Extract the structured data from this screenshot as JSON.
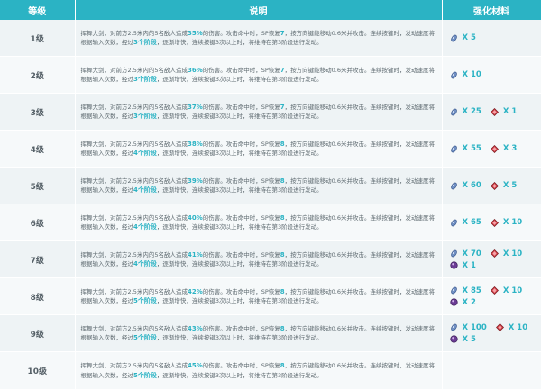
{
  "header": {
    "level": "等级",
    "description": "说明",
    "materials": "强化材料"
  },
  "colors": {
    "header_bg": "#2bb3c4",
    "highlight": "#2bb3c4",
    "row_bg_a": "#eef3f5",
    "row_bg_b": "#f6f9fa"
  },
  "icons": {
    "a": "blue-crystal-icon",
    "b": "red-crystal-icon",
    "c": "purple-orb-icon"
  },
  "rows": [
    {
      "level": "1级",
      "d": [
        "挥舞大剑，对前方2.5米内的5名敌人造成",
        "35%",
        "的伤害。攻击命中时，SP恢复",
        "7",
        "，按方向键能移动0.6米并攻击。连续按键时，发动速度将根据输入次数，经过",
        "3个阶段",
        "，逐渐增快，连续按键3次以上时，将维持在第3阶段进行发动。"
      ],
      "mats": [
        [
          {
            "icon": "blue-crystal-icon",
            "qty": "X 5"
          }
        ]
      ]
    },
    {
      "level": "2级",
      "d": [
        "挥舞大剑，对前方2.5米内的5名敌人造成",
        "36%",
        "的伤害。攻击命中时，SP恢复",
        "7",
        "，按方向键能移动0.6米并攻击。连续按键时，发动速度将根据输入次数，经过",
        "3个阶段",
        "，逐渐增快，连续按键3次以上时，将维持在第3阶段进行发动。"
      ],
      "mats": [
        [
          {
            "icon": "blue-crystal-icon",
            "qty": "X 10"
          }
        ]
      ]
    },
    {
      "level": "3级",
      "d": [
        "挥舞大剑，对前方2.5米内的5名敌人造成",
        "37%",
        "的伤害。攻击命中时，SP恢复",
        "7",
        "，按方向键能移动0.6米并攻击。连续按键时，发动速度将根据输入次数，经过",
        "3个阶段",
        "，逐渐增快，连续按键3次以上时，将维持在第3阶段进行发动。"
      ],
      "mats": [
        [
          {
            "icon": "blue-crystal-icon",
            "qty": "X 25"
          },
          {
            "icon": "red-crystal-icon",
            "qty": "X 1"
          }
        ]
      ]
    },
    {
      "level": "4级",
      "d": [
        "挥舞大剑，对前方2.5米内的5名敌人造成",
        "38%",
        "的伤害。攻击命中时，SP恢复",
        "8",
        "，按方向键能移动0.6米并攻击。连续按键时，发动速度将根据输入次数，经过",
        "4个阶段",
        "，逐渐增快，连续按键3次以上时，将维持在第3阶段进行发动。"
      ],
      "mats": [
        [
          {
            "icon": "blue-crystal-icon",
            "qty": "X 55"
          },
          {
            "icon": "red-crystal-icon",
            "qty": "X 3"
          }
        ]
      ]
    },
    {
      "level": "5级",
      "d": [
        "挥舞大剑，对前方2.5米内的5名敌人造成",
        "39%",
        "的伤害。攻击命中时，SP恢复",
        "8",
        "，按方向键能移动0.6米并攻击。连续按键时，发动速度将根据输入次数，经过",
        "4个阶段",
        "，逐渐增快，连续按键3次以上时，将维持在第3阶段进行发动。"
      ],
      "mats": [
        [
          {
            "icon": "blue-crystal-icon",
            "qty": "X 60"
          },
          {
            "icon": "red-crystal-icon",
            "qty": "X 5"
          }
        ]
      ]
    },
    {
      "level": "6级",
      "d": [
        "挥舞大剑，对前方2.5米内的5名敌人造成",
        "40%",
        "的伤害。攻击命中时，SP恢复",
        "8",
        "，按方向键能移动0.6米并攻击。连续按键时，发动速度将根据输入次数，经过",
        "4个阶段",
        "，逐渐增快，连续按键3次以上时，将维持在第3阶段进行发动。"
      ],
      "mats": [
        [
          {
            "icon": "blue-crystal-icon",
            "qty": "X 65"
          },
          {
            "icon": "red-crystal-icon",
            "qty": "X 10"
          }
        ]
      ]
    },
    {
      "level": "7级",
      "d": [
        "挥舞大剑，对前方2.5米内的5名敌人造成",
        "41%",
        "的伤害。攻击命中时，SP恢复",
        "8",
        "，按方向键能移动0.6米并攻击。连续按键时，发动速度将根据输入次数，经过",
        "4个阶段",
        "，逐渐增快，连续按键3次以上时，将维持在第3阶段进行发动。"
      ],
      "mats": [
        [
          {
            "icon": "blue-crystal-icon",
            "qty": "X 70"
          },
          {
            "icon": "red-crystal-icon",
            "qty": "X 10"
          }
        ],
        [
          {
            "icon": "purple-orb-icon",
            "qty": "X 1"
          }
        ]
      ]
    },
    {
      "level": "8级",
      "d": [
        "挥舞大剑，对前方2.5米内的5名敌人造成",
        "42%",
        "的伤害。攻击命中时，SP恢复",
        "8",
        "，按方向键能移动0.6米并攻击。连续按键时，发动速度将根据输入次数，经过",
        "5个阶段",
        "，逐渐增快，连续按键3次以上时，将维持在第3阶段进行发动。"
      ],
      "mats": [
        [
          {
            "icon": "blue-crystal-icon",
            "qty": "X 85"
          },
          {
            "icon": "red-crystal-icon",
            "qty": "X 10"
          }
        ],
        [
          {
            "icon": "purple-orb-icon",
            "qty": "X 2"
          }
        ]
      ]
    },
    {
      "level": "9级",
      "d": [
        "挥舞大剑，对前方2.5米内的5名敌人造成",
        "43%",
        "的伤害。攻击命中时，SP恢复",
        "8",
        "，按方向键能移动0.6米并攻击。连续按键时，发动速度将根据输入次数，经过",
        "5个阶段",
        "，逐渐增快，连续按键3次以上时，将维持在第3阶段进行发动。"
      ],
      "mats": [
        [
          {
            "icon": "blue-crystal-icon",
            "qty": "X 100"
          },
          {
            "icon": "red-crystal-icon",
            "qty": "X 10"
          }
        ],
        [
          {
            "icon": "purple-orb-icon",
            "qty": "X 5"
          }
        ]
      ]
    },
    {
      "level": "10级",
      "d": [
        "挥舞大剑，对前方2.5米内的5名敌人造成",
        "45%",
        "的伤害。攻击命中时，SP恢复",
        "8",
        "，按方向键能移动0.6米并攻击。连续按键时，发动速度将根据输入次数，经过",
        "5个阶段",
        "，逐渐增快，连续按键3次以上时，将维持在第3阶段进行发动。"
      ],
      "mats": []
    }
  ]
}
